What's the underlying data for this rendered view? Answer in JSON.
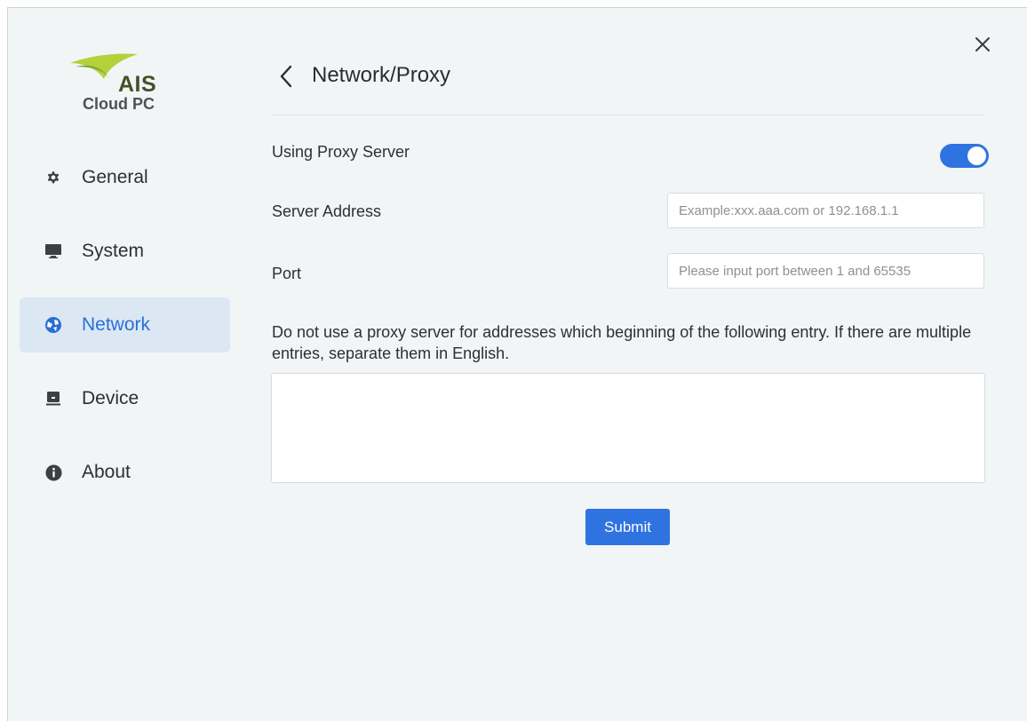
{
  "app": {
    "logo_brand": "AIS",
    "logo_product": "Cloud PC"
  },
  "sidebar": {
    "items": [
      {
        "label": "General",
        "icon": "gear-icon",
        "active": false
      },
      {
        "label": "System",
        "icon": "monitor-icon",
        "active": false
      },
      {
        "label": "Network",
        "icon": "globe-icon",
        "active": true
      },
      {
        "label": "Device",
        "icon": "device-icon",
        "active": false
      },
      {
        "label": "About",
        "icon": "info-icon",
        "active": false
      }
    ]
  },
  "header": {
    "title": "Network/Proxy",
    "back_icon": "chevron-left-icon",
    "close_icon": "close-icon"
  },
  "proxy": {
    "using_label": "Using Proxy Server",
    "using_enabled": true,
    "server_label": "Server Address",
    "server_value": "",
    "server_placeholder": "Example:xxx.aaa.com or 192.168.1.1",
    "port_label": "Port",
    "port_value": "",
    "port_placeholder": "Please input port between 1 and 65535",
    "bypass_description": "Do not use a proxy server for addresses which beginning of the following entry. If there are multiple entries, separate them in English.",
    "bypass_value": "",
    "submit_label": "Submit"
  },
  "colors": {
    "accent": "#2f73e0",
    "active_nav_bg": "#dce7f4",
    "window_bg": "#f1f5f6",
    "logo_green": "#a7c93a"
  }
}
